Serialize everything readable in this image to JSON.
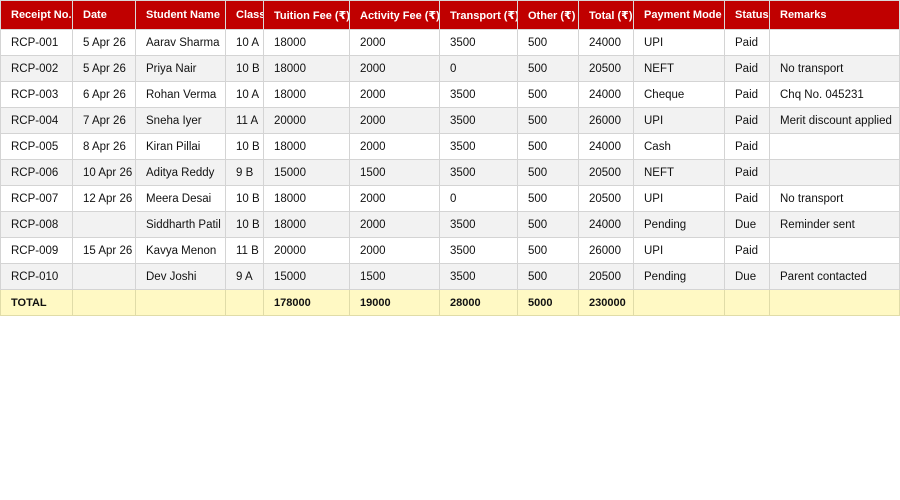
{
  "table": {
    "headers": [
      "Receipt No.",
      "Date",
      "Student Name",
      "Class",
      "Tuition Fee (₹)",
      "Activity Fee (₹)",
      "Transport (₹)",
      "Other (₹)",
      "Total (₹)",
      "Payment Mode",
      "Status",
      "Remarks"
    ],
    "rows": [
      [
        "RCP-001",
        "5 Apr 26",
        "Aarav Sharma",
        "10 A",
        "18000",
        "2000",
        "3500",
        "500",
        "24000",
        "UPI",
        "Paid",
        ""
      ],
      [
        "RCP-002",
        "5 Apr 26",
        "Priya Nair",
        "10 B",
        "18000",
        "2000",
        "0",
        "500",
        "20500",
        "NEFT",
        "Paid",
        "No transport"
      ],
      [
        "RCP-003",
        "6 Apr 26",
        "Rohan Verma",
        "10 A",
        "18000",
        "2000",
        "3500",
        "500",
        "24000",
        "Cheque",
        "Paid",
        "Chq No. 045231"
      ],
      [
        "RCP-004",
        "7 Apr 26",
        "Sneha Iyer",
        "11 A",
        "20000",
        "2000",
        "3500",
        "500",
        "26000",
        "UPI",
        "Paid",
        "Merit discount applied"
      ],
      [
        "RCP-005",
        "8 Apr 26",
        "Kiran Pillai",
        "10 B",
        "18000",
        "2000",
        "3500",
        "500",
        "24000",
        "Cash",
        "Paid",
        ""
      ],
      [
        "RCP-006",
        "10 Apr 26",
        "Aditya Reddy",
        "9 B",
        "15000",
        "1500",
        "3500",
        "500",
        "20500",
        "NEFT",
        "Paid",
        ""
      ],
      [
        "RCP-007",
        "12 Apr 26",
        "Meera Desai",
        "10 B",
        "18000",
        "2000",
        "0",
        "500",
        "20500",
        "UPI",
        "Paid",
        "No transport"
      ],
      [
        "RCP-008",
        "",
        "Siddharth Patil",
        "10 B",
        "18000",
        "2000",
        "3500",
        "500",
        "24000",
        "Pending",
        "Due",
        "Reminder sent"
      ],
      [
        "RCP-009",
        "15 Apr 26",
        "Kavya Menon",
        "11 B",
        "20000",
        "2000",
        "3500",
        "500",
        "26000",
        "UPI",
        "Paid",
        ""
      ],
      [
        "RCP-010",
        "",
        "Dev Joshi",
        "9 A",
        "15000",
        "1500",
        "3500",
        "500",
        "20500",
        "Pending",
        "Due",
        "Parent contacted"
      ]
    ],
    "total_row": [
      "TOTAL",
      "",
      "",
      "",
      "178000",
      "19000",
      "28000",
      "5000",
      "230000",
      "",
      "",
      ""
    ]
  },
  "colors": {
    "header_background": "#c00000",
    "header_text": "#ffffff",
    "alternate_row": "#f2f2f2",
    "total_row_background": "#fff9c4",
    "grid_line": "#d4d4d4"
  }
}
